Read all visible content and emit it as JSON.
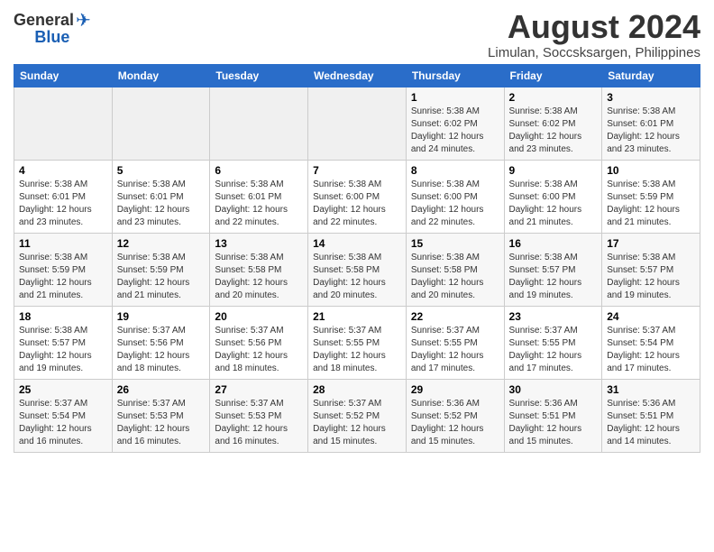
{
  "logo": {
    "general": "General",
    "blue": "Blue"
  },
  "title": {
    "month_year": "August 2024",
    "location": "Limulan, Soccsksargen, Philippines"
  },
  "headers": [
    "Sunday",
    "Monday",
    "Tuesday",
    "Wednesday",
    "Thursday",
    "Friday",
    "Saturday"
  ],
  "weeks": [
    [
      {
        "day": "",
        "info": ""
      },
      {
        "day": "",
        "info": ""
      },
      {
        "day": "",
        "info": ""
      },
      {
        "day": "",
        "info": ""
      },
      {
        "day": "1",
        "info": "Sunrise: 5:38 AM\nSunset: 6:02 PM\nDaylight: 12 hours\nand 24 minutes."
      },
      {
        "day": "2",
        "info": "Sunrise: 5:38 AM\nSunset: 6:02 PM\nDaylight: 12 hours\nand 23 minutes."
      },
      {
        "day": "3",
        "info": "Sunrise: 5:38 AM\nSunset: 6:01 PM\nDaylight: 12 hours\nand 23 minutes."
      }
    ],
    [
      {
        "day": "4",
        "info": "Sunrise: 5:38 AM\nSunset: 6:01 PM\nDaylight: 12 hours\nand 23 minutes."
      },
      {
        "day": "5",
        "info": "Sunrise: 5:38 AM\nSunset: 6:01 PM\nDaylight: 12 hours\nand 23 minutes."
      },
      {
        "day": "6",
        "info": "Sunrise: 5:38 AM\nSunset: 6:01 PM\nDaylight: 12 hours\nand 22 minutes."
      },
      {
        "day": "7",
        "info": "Sunrise: 5:38 AM\nSunset: 6:00 PM\nDaylight: 12 hours\nand 22 minutes."
      },
      {
        "day": "8",
        "info": "Sunrise: 5:38 AM\nSunset: 6:00 PM\nDaylight: 12 hours\nand 22 minutes."
      },
      {
        "day": "9",
        "info": "Sunrise: 5:38 AM\nSunset: 6:00 PM\nDaylight: 12 hours\nand 21 minutes."
      },
      {
        "day": "10",
        "info": "Sunrise: 5:38 AM\nSunset: 5:59 PM\nDaylight: 12 hours\nand 21 minutes."
      }
    ],
    [
      {
        "day": "11",
        "info": "Sunrise: 5:38 AM\nSunset: 5:59 PM\nDaylight: 12 hours\nand 21 minutes."
      },
      {
        "day": "12",
        "info": "Sunrise: 5:38 AM\nSunset: 5:59 PM\nDaylight: 12 hours\nand 21 minutes."
      },
      {
        "day": "13",
        "info": "Sunrise: 5:38 AM\nSunset: 5:58 PM\nDaylight: 12 hours\nand 20 minutes."
      },
      {
        "day": "14",
        "info": "Sunrise: 5:38 AM\nSunset: 5:58 PM\nDaylight: 12 hours\nand 20 minutes."
      },
      {
        "day": "15",
        "info": "Sunrise: 5:38 AM\nSunset: 5:58 PM\nDaylight: 12 hours\nand 20 minutes."
      },
      {
        "day": "16",
        "info": "Sunrise: 5:38 AM\nSunset: 5:57 PM\nDaylight: 12 hours\nand 19 minutes."
      },
      {
        "day": "17",
        "info": "Sunrise: 5:38 AM\nSunset: 5:57 PM\nDaylight: 12 hours\nand 19 minutes."
      }
    ],
    [
      {
        "day": "18",
        "info": "Sunrise: 5:38 AM\nSunset: 5:57 PM\nDaylight: 12 hours\nand 19 minutes."
      },
      {
        "day": "19",
        "info": "Sunrise: 5:37 AM\nSunset: 5:56 PM\nDaylight: 12 hours\nand 18 minutes."
      },
      {
        "day": "20",
        "info": "Sunrise: 5:37 AM\nSunset: 5:56 PM\nDaylight: 12 hours\nand 18 minutes."
      },
      {
        "day": "21",
        "info": "Sunrise: 5:37 AM\nSunset: 5:55 PM\nDaylight: 12 hours\nand 18 minutes."
      },
      {
        "day": "22",
        "info": "Sunrise: 5:37 AM\nSunset: 5:55 PM\nDaylight: 12 hours\nand 17 minutes."
      },
      {
        "day": "23",
        "info": "Sunrise: 5:37 AM\nSunset: 5:55 PM\nDaylight: 12 hours\nand 17 minutes."
      },
      {
        "day": "24",
        "info": "Sunrise: 5:37 AM\nSunset: 5:54 PM\nDaylight: 12 hours\nand 17 minutes."
      }
    ],
    [
      {
        "day": "25",
        "info": "Sunrise: 5:37 AM\nSunset: 5:54 PM\nDaylight: 12 hours\nand 16 minutes."
      },
      {
        "day": "26",
        "info": "Sunrise: 5:37 AM\nSunset: 5:53 PM\nDaylight: 12 hours\nand 16 minutes."
      },
      {
        "day": "27",
        "info": "Sunrise: 5:37 AM\nSunset: 5:53 PM\nDaylight: 12 hours\nand 16 minutes."
      },
      {
        "day": "28",
        "info": "Sunrise: 5:37 AM\nSunset: 5:52 PM\nDaylight: 12 hours\nand 15 minutes."
      },
      {
        "day": "29",
        "info": "Sunrise: 5:36 AM\nSunset: 5:52 PM\nDaylight: 12 hours\nand 15 minutes."
      },
      {
        "day": "30",
        "info": "Sunrise: 5:36 AM\nSunset: 5:51 PM\nDaylight: 12 hours\nand 15 minutes."
      },
      {
        "day": "31",
        "info": "Sunrise: 5:36 AM\nSunset: 5:51 PM\nDaylight: 12 hours\nand 14 minutes."
      }
    ]
  ]
}
